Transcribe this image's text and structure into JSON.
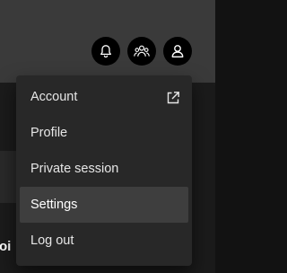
{
  "header": {
    "icons": [
      "bell-icon",
      "friends-icon",
      "user-icon"
    ]
  },
  "background": {
    "partial_text": "oi"
  },
  "menu": {
    "items": [
      {
        "label": "Account",
        "trailing_icon": "external-link-icon"
      },
      {
        "label": "Profile"
      },
      {
        "label": "Private session"
      },
      {
        "label": "Settings",
        "highlighted": true
      },
      {
        "label": "Log out"
      }
    ]
  },
  "colors": {
    "menu_bg": "#282828",
    "menu_hover": "#3e3e3e",
    "header_bg": "#3a3a3a",
    "icon_button_bg": "#000000"
  }
}
